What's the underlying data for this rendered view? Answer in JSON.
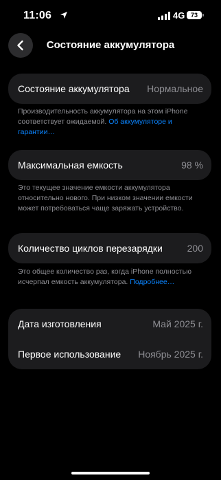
{
  "status_bar": {
    "time": "11:06",
    "network": "4G",
    "battery_level": "73"
  },
  "header": {
    "title": "Состояние аккумулятора"
  },
  "battery_health": {
    "label": "Состояние аккумулятора",
    "value": "Нормальное",
    "footnote_text": "Производительность аккумулятора на этом iPhone соответствует ожидаемой.",
    "footnote_link": "Об аккумуляторе и гарантии…"
  },
  "max_capacity": {
    "label": "Максимальная емкость",
    "value": "98 %",
    "footnote_text": "Это текущее значение емкости аккумулятора относительно нового. При низком значении емкости может потребоваться чаще заряжать устройство."
  },
  "cycle_count": {
    "label": "Количество циклов перезарядки",
    "value": "200",
    "footnote_text": "Это общее количество раз, когда iPhone полностью исчерпал емкость аккумулятора.",
    "footnote_link": "Подробнее…"
  },
  "dates": {
    "manufacture_label": "Дата изготовления",
    "manufacture_value": "Май 2025 г.",
    "first_use_label": "Первое использование",
    "first_use_value": "Ноябрь 2025 г."
  },
  "colors": {
    "background": "#000000",
    "card": "#1c1c1e",
    "secondary_text": "#8e8e93",
    "link": "#0a84ff"
  }
}
